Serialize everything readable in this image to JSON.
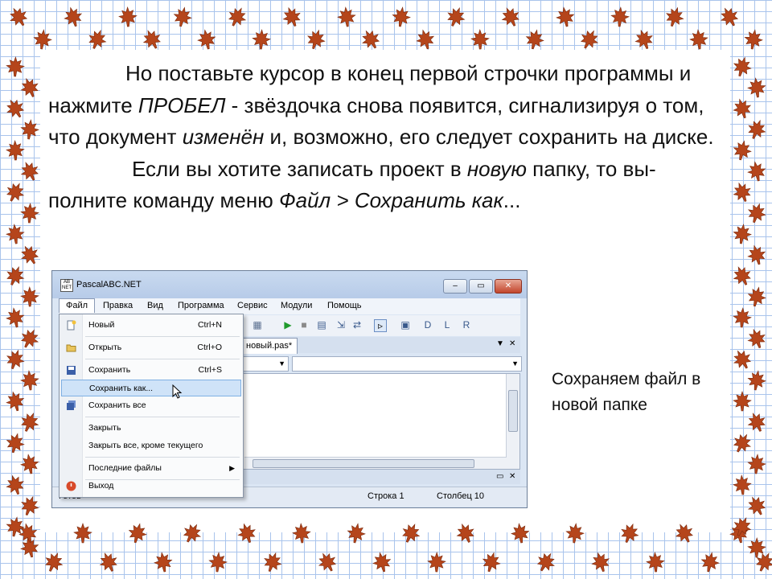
{
  "text": {
    "p1_a": "Но поставьте курсор в конец первой строчки программы и нажмите ",
    "p1_b": "ПРОБЕЛ",
    "p1_c": " - звёздочка снова появится, сигнализируя о том, что документ ",
    "p1_d": "изменён",
    "p1_e": " и, возможно, его следует сохранить на диске.",
    "p2_a": "Если вы хотите записать проект в ",
    "p2_b": "новую",
    "p2_c": " папку, то вы- полните команду меню ",
    "p2_d": "Файл > Сохранить как",
    "p2_e": "..."
  },
  "caption": "Сохраняем файл в новой папке",
  "window": {
    "title": "PascalABC.NET",
    "app_icon_text": "AB NET",
    "menu": [
      "Файл",
      "Правка",
      "Вид",
      "Программа",
      "Сервис",
      "Модули",
      "Помощь"
    ],
    "tab_label": "новый.pas*",
    "status": {
      "left": "Готов",
      "row": "Строка  1",
      "col": "Столбец  10"
    }
  },
  "file_menu": {
    "items": [
      {
        "label": "Новый",
        "shortcut": "Ctrl+N",
        "icon": "new-file-icon"
      },
      {
        "label": "Открыть",
        "shortcut": "Ctrl+O",
        "icon": "open-folder-icon"
      },
      {
        "label": "Сохранить",
        "shortcut": "Ctrl+S",
        "icon": "save-disk-icon"
      },
      {
        "label": "Сохранить как...",
        "shortcut": "",
        "icon": "",
        "highlighted": true
      },
      {
        "label": "Сохранить все",
        "shortcut": "",
        "icon": "save-all-icon"
      },
      {
        "label": "Закрыть",
        "shortcut": "",
        "icon": ""
      },
      {
        "label": "Закрыть все, кроме текущего",
        "shortcut": "",
        "icon": ""
      },
      {
        "label": "Последние файлы",
        "shortcut": "",
        "icon": "",
        "submenu": true
      },
      {
        "label": "Выход",
        "shortcut": "",
        "icon": "exit-icon"
      }
    ]
  },
  "colors": {
    "grid": "#a9c4ec",
    "leaf": "#b5451b",
    "highlight": "#cfe3f8"
  }
}
